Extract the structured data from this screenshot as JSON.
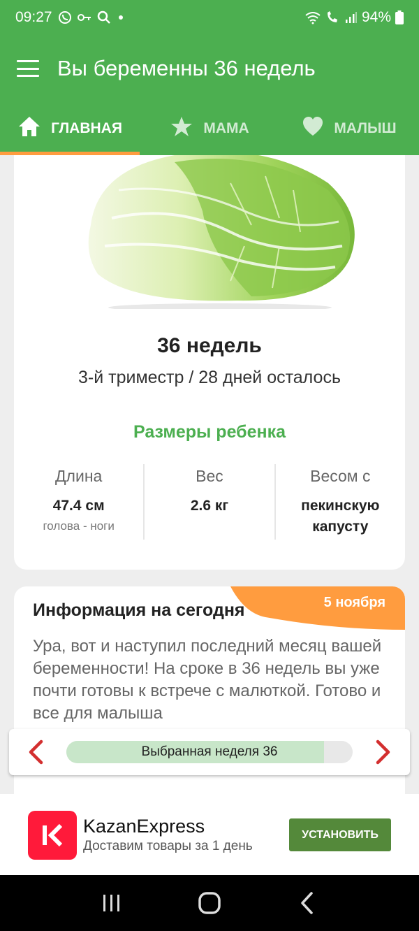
{
  "status_bar": {
    "time": "09:27",
    "battery": "94%",
    "icons": [
      "viber-icon",
      "key-icon",
      "search-icon",
      "dot-icon",
      "wifi-icon",
      "wifi-calling-icon",
      "signal-icon",
      "battery-icon"
    ]
  },
  "app_bar": {
    "title": "Вы беременны 36 недель",
    "menu_icon": "hamburger-menu-icon"
  },
  "tabs": [
    {
      "label": "ГЛАВНАЯ",
      "icon": "home-icon",
      "active": true
    },
    {
      "label": "МАМА",
      "icon": "star-icon",
      "active": false
    },
    {
      "label": "МАЛЫШ",
      "icon": "heart-icon",
      "active": false
    }
  ],
  "main_card": {
    "image": "napa-cabbage-image",
    "week_title": "36 недель",
    "trimester_text": "3-й триместр / 28 дней осталось",
    "sizes_title": "Размеры ребенка",
    "sizes": [
      {
        "label": "Длина",
        "value": "47.4 см",
        "sub": "голова - ноги"
      },
      {
        "label": "Вес",
        "value": "2.6 кг",
        "sub": ""
      },
      {
        "label": "Весом с",
        "value": "пекинскую капусту",
        "sub": ""
      }
    ]
  },
  "info_card": {
    "title": "Информация на сегодня",
    "date": "5 ноября",
    "body": "Ура, вот и наступил последний месяц вашей беременности! На сроке в 36 недель вы уже почти готовы к встрече с малюткой. Готово и все для малыша"
  },
  "week_selector": {
    "label": "Выбранная неделя 36",
    "progress": 0.9
  },
  "ad": {
    "title": "KazanExpress",
    "subtitle": "Доставим товары за 1 день",
    "button_label": "УСТАНОВИТЬ"
  },
  "colors": {
    "primary_green": "#4caf50",
    "accent_orange": "#ff9c3f",
    "arrow_red": "#d32f2f",
    "ad_button_green": "#54893a",
    "ad_logo_red": "#ff1a3a"
  }
}
